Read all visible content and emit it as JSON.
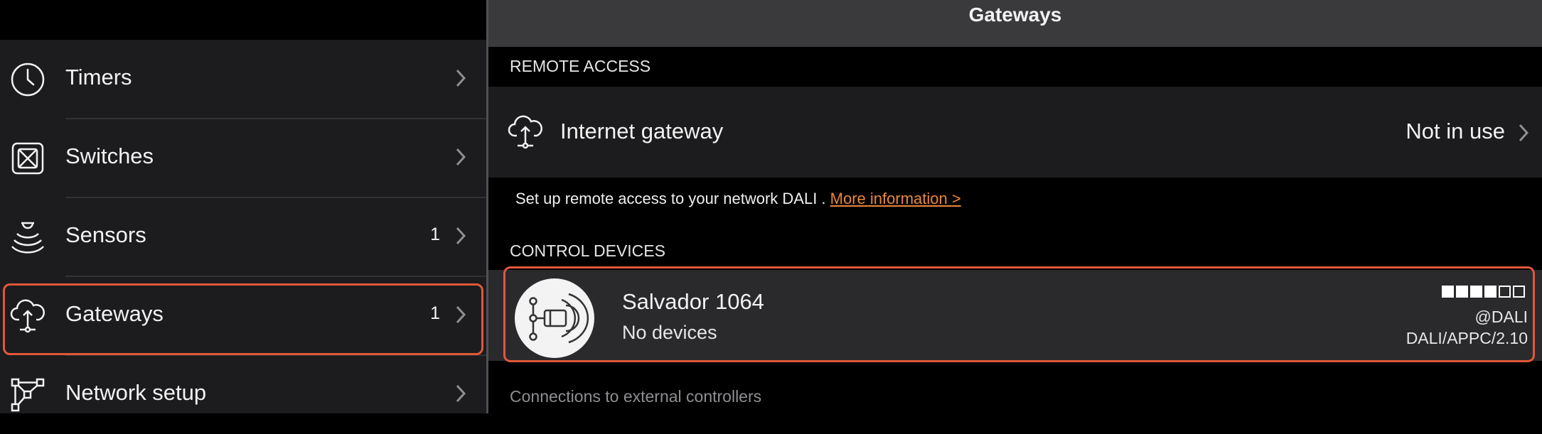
{
  "sidebar": {
    "items": [
      {
        "label": "Timers",
        "count": "",
        "icon": "clock-icon"
      },
      {
        "label": "Switches",
        "count": "",
        "icon": "switch-icon"
      },
      {
        "label": "Sensors",
        "count": "1",
        "icon": "sensor-icon"
      },
      {
        "label": "Gateways",
        "count": "1",
        "icon": "cloud-gateway-icon",
        "selected": true
      },
      {
        "label": "Network setup",
        "count": "",
        "icon": "network-icon"
      }
    ]
  },
  "header": {
    "title": "Gateways"
  },
  "remote_access": {
    "section_title": "REMOTE ACCESS",
    "gateway_label": "Internet gateway",
    "gateway_value": "Not in use",
    "info_text": "Set up remote access to your network DALI .",
    "info_link": "More information >"
  },
  "control_devices": {
    "section_title": "CONTROL DEVICES",
    "device": {
      "name": "Salvador 1064",
      "subtitle": "No devices",
      "address": "@DALI",
      "version": "DALI/APPC/2.10",
      "signal_strength": "4/6"
    }
  },
  "external": {
    "label": "Connections to external controllers"
  },
  "colors": {
    "highlight": "#e2573a",
    "link": "#e8873b",
    "row_bg": "#1c1c1e",
    "selected_row_bg": "#2a2a2d"
  }
}
